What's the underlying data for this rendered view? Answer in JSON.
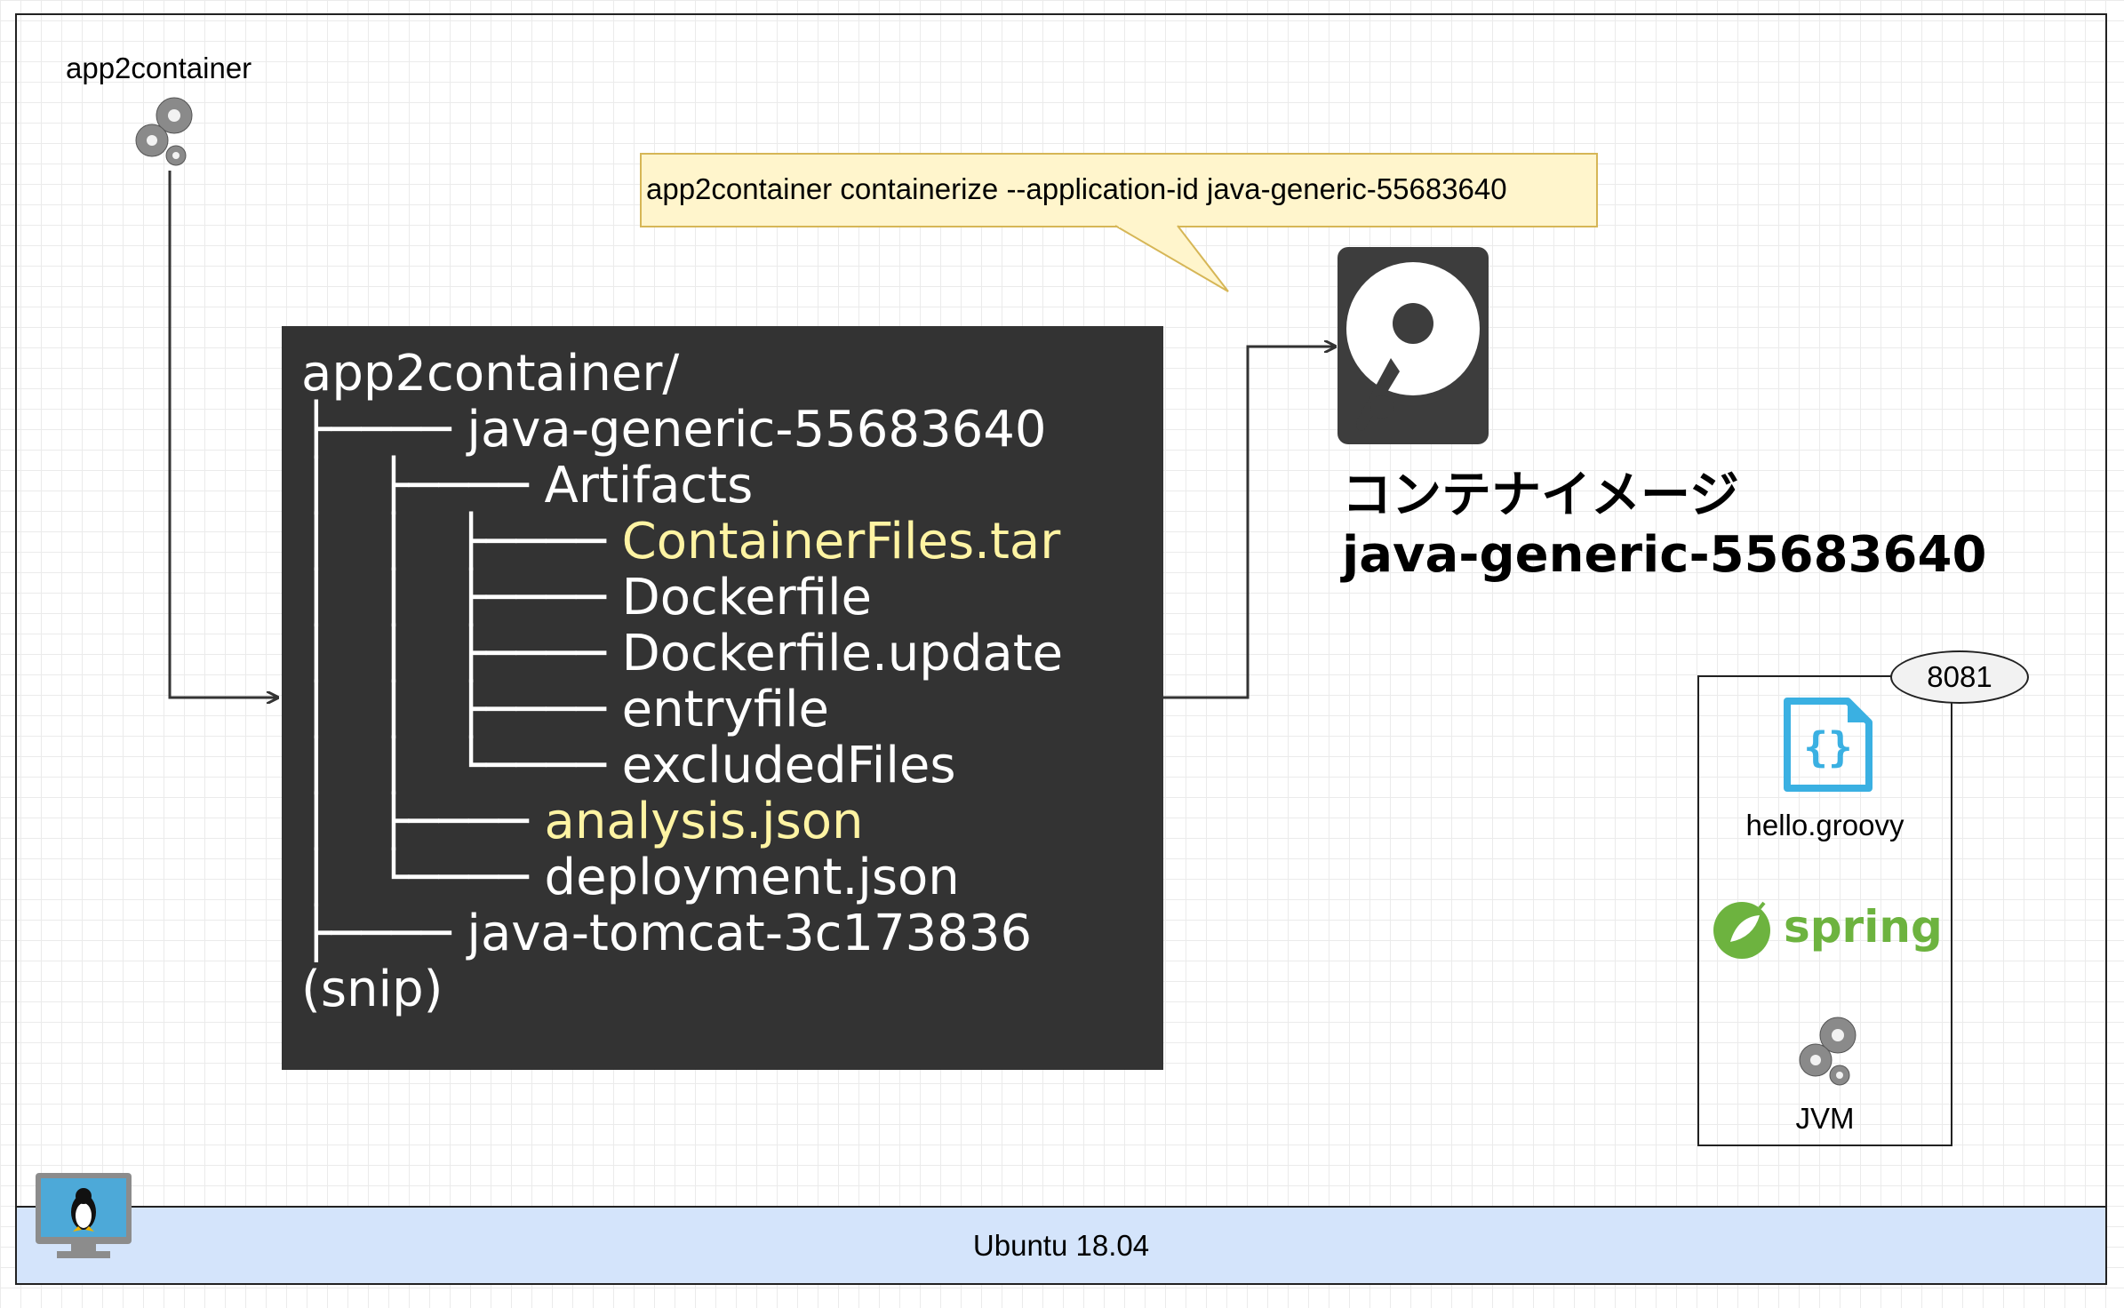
{
  "tool": {
    "label": "app2container",
    "icon": "gears-icon"
  },
  "callout": {
    "text": "app2container containerize --application-id java-generic-55683640"
  },
  "tree": {
    "lines": [
      {
        "prefix": "",
        "name": "app2container/",
        "highlight": false
      },
      {
        "prefix": "├────",
        "name": "java-generic-55683640",
        "highlight": false
      },
      {
        "prefix": "│   ├────",
        "name": "Artifacts",
        "highlight": false
      },
      {
        "prefix": "│   │   ├────",
        "name": "ContainerFiles.tar",
        "highlight": true
      },
      {
        "prefix": "│   │   ├────",
        "name": "Dockerfile",
        "highlight": false
      },
      {
        "prefix": "│   │   ├────",
        "name": "Dockerfile.update",
        "highlight": false
      },
      {
        "prefix": "│   │   ├────",
        "name": "entryfile",
        "highlight": false
      },
      {
        "prefix": "│   │   └────",
        "name": "excludedFiles",
        "highlight": false
      },
      {
        "prefix": "│   ├────",
        "name": "analysis.json",
        "highlight": true
      },
      {
        "prefix": "│   └────",
        "name": "deployment.json",
        "highlight": false
      },
      {
        "prefix": "├────",
        "name": "java-tomcat-3c173836",
        "highlight": false
      },
      {
        "prefix": "",
        "name": "(snip)",
        "highlight": false
      }
    ],
    "highlight_color": "#fff4a3"
  },
  "image": {
    "icon": "hard-disk-icon",
    "title": "コンテナイメージ",
    "name": "java-generic-55683640"
  },
  "app": {
    "port": "8081",
    "items": [
      {
        "icon": "code-file-icon",
        "label": "hello.groovy"
      },
      {
        "icon": "spring-logo",
        "label": "spring"
      },
      {
        "icon": "gears-icon",
        "label": "JVM"
      }
    ]
  },
  "host": {
    "label": "Ubuntu 18.04",
    "icon": "linux-monitor-icon"
  },
  "colors": {
    "tree_bg": "#333333",
    "callout_bg": "#fff5cc",
    "host_bg": "#d4e4fb",
    "spring_green": "#6db33f",
    "code_blue": "#3ab0e2"
  }
}
